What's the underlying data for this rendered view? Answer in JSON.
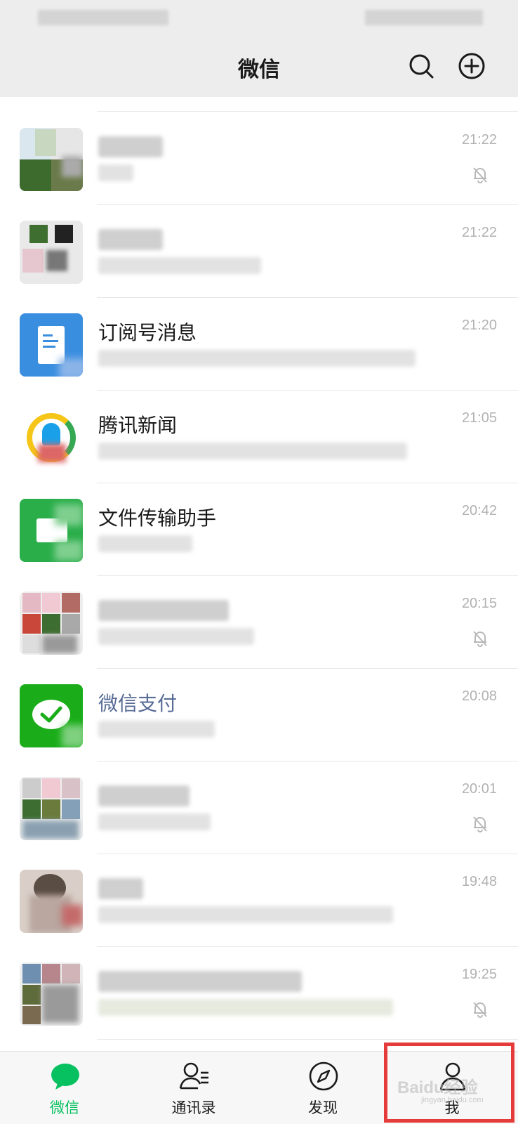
{
  "header": {
    "title": "微信",
    "search_icon": "search-icon",
    "add_icon": "plus-circle-icon"
  },
  "chats": [
    {
      "name": "",
      "time": "21:22",
      "muted": true
    },
    {
      "name": "",
      "time": "21:22",
      "muted": false
    },
    {
      "name": "订阅号消息",
      "time": "21:20",
      "muted": false
    },
    {
      "name": "腾讯新闻",
      "time": "21:05",
      "muted": false
    },
    {
      "name": "文件传输助手",
      "time": "20:42",
      "muted": false
    },
    {
      "name": "",
      "time": "20:15",
      "muted": true
    },
    {
      "name": "微信支付",
      "time": "20:08",
      "muted": false
    },
    {
      "name": "",
      "time": "20:01",
      "muted": true
    },
    {
      "name": "",
      "time": "19:48",
      "muted": false
    },
    {
      "name": "",
      "time": "19:25",
      "muted": true
    }
  ],
  "tabs": [
    {
      "label": "微信",
      "icon": "chat-bubble-icon",
      "active": true
    },
    {
      "label": "通讯录",
      "icon": "contacts-icon",
      "active": false
    },
    {
      "label": "发现",
      "icon": "compass-icon",
      "active": false
    },
    {
      "label": "我",
      "icon": "person-icon",
      "active": false
    }
  ],
  "watermark": {
    "brand": "Baidu经验",
    "url": "jingyan.baidu.com"
  },
  "colors": {
    "accent": "#07c160",
    "highlight": "#e53b3b",
    "pay_name": "#576b95"
  }
}
